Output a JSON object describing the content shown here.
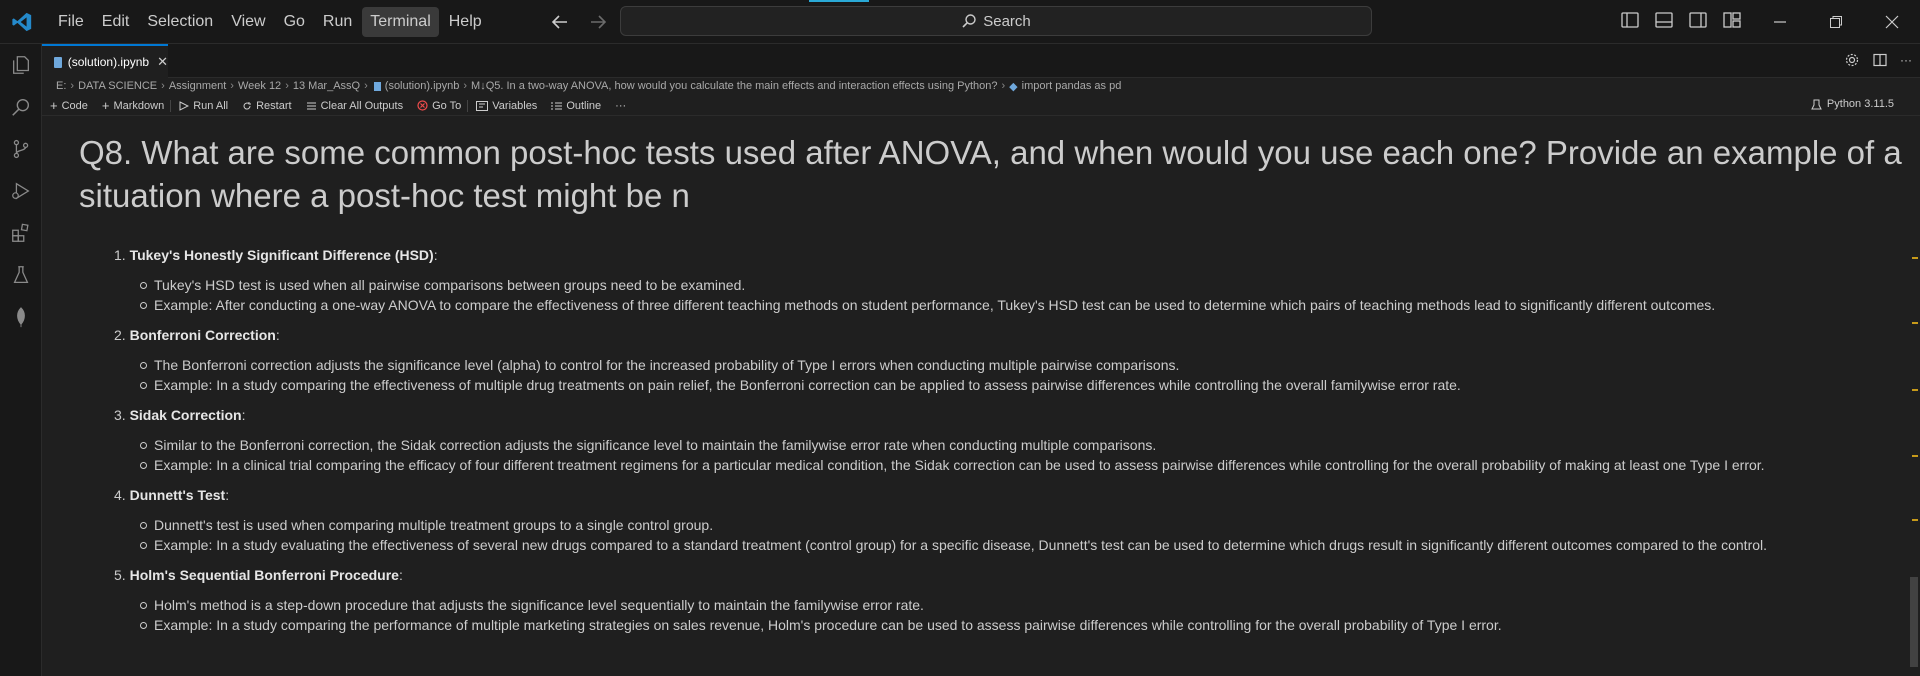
{
  "menu": {
    "items": [
      "File",
      "Edit",
      "Selection",
      "View",
      "Go",
      "Run",
      "Terminal",
      "Help"
    ],
    "active": "Terminal"
  },
  "search": {
    "label": "Search"
  },
  "tab": {
    "label": "(solution).ipynb"
  },
  "breadcrumb": [
    "E:",
    "DATA SCIENCE",
    "Assignment",
    "Week 12",
    "13 Mar_AssQ",
    "(solution).ipynb",
    "M↓Q5. In a two-way ANOVA, how would you calculate the main effects and interaction effects using Python?",
    "import pandas as pd"
  ],
  "toolbar": {
    "code": "Code",
    "markdown": "Markdown",
    "run_all": "Run All",
    "restart": "Restart",
    "clear_outputs": "Clear All Outputs",
    "goto": "Go To",
    "variables": "Variables",
    "outline": "Outline",
    "more": "···",
    "kernel": "Python 3.11.5"
  },
  "heading": {
    "line1": "Q8. What are some common post-hoc tests used after ANOVA, and when would you use each one? Provide an example of a",
    "line2": "situation where a post-hoc test might be n"
  },
  "items": [
    {
      "number": "1.",
      "title": "Tukey's Honestly Significant Difference (HSD)",
      "bullets": [
        "Tukey's HSD test is used when all pairwise comparisons between groups need to be examined.",
        "Example: After conducting a one-way ANOVA to compare the effectiveness of three different teaching methods on student performance, Tukey's HSD test can be used to determine which pairs of teaching methods lead to significantly different outcomes."
      ]
    },
    {
      "number": "2.",
      "title": "Bonferroni Correction",
      "bullets": [
        "The Bonferroni correction adjusts the significance level (alpha) to control for the increased probability of Type I errors when conducting multiple pairwise comparisons.",
        "Example: In a study comparing the effectiveness of multiple drug treatments on pain relief, the Bonferroni correction can be applied to assess pairwise differences while controlling the overall familywise error rate."
      ]
    },
    {
      "number": "3.",
      "title": "Sidak Correction",
      "bullets": [
        "Similar to the Bonferroni correction, the Sidak correction adjusts the significance level to maintain the familywise error rate when conducting multiple comparisons.",
        "Example: In a clinical trial comparing the efficacy of four different treatment regimens for a particular medical condition, the Sidak correction can be used to assess pairwise differences while controlling for the overall probability of making at least one Type I error."
      ]
    },
    {
      "number": "4.",
      "title": "Dunnett's Test",
      "bullets": [
        "Dunnett's test is used when comparing multiple treatment groups to a single control group.",
        "Example: In a study evaluating the effectiveness of several new drugs compared to a standard treatment (control group) for a specific disease, Dunnett's test can be used to determine which drugs result in significantly different outcomes compared to the control."
      ]
    },
    {
      "number": "5.",
      "title": "Holm's Sequential Bonferroni Procedure",
      "bullets": [
        "Holm's method is a step-down procedure that adjusts the significance level sequentially to maintain the familywise error rate.",
        "Example: In a study comparing the performance of multiple marketing strategies on sales revenue, Holm's procedure can be used to assess pairwise differences while controlling for the overall probability of Type I error."
      ]
    }
  ]
}
